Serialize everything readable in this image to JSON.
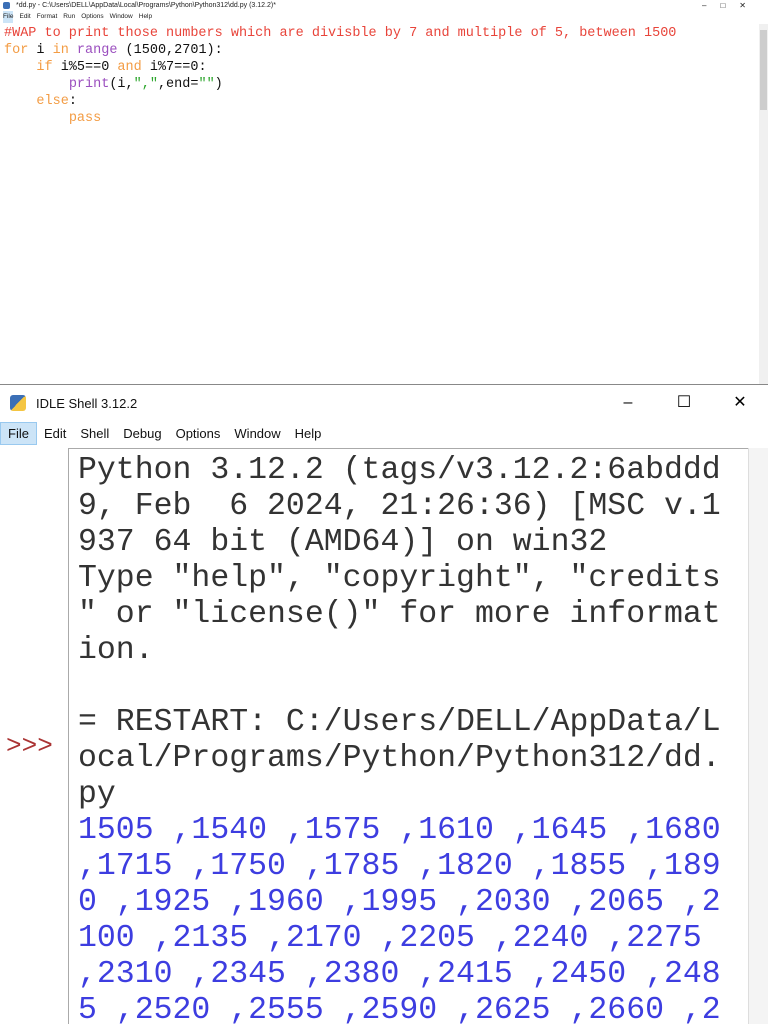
{
  "editor": {
    "title": "*dd.py - C:\\Users\\DELL\\AppData\\Local\\Programs\\Python\\Python312\\dd.py (3.12.2)*",
    "controls": [
      "–",
      "□",
      "✕"
    ],
    "menu": [
      "File",
      "Edit",
      "Format",
      "Run",
      "Options",
      "Window",
      "Help"
    ],
    "code": {
      "l1": "#WAP to print those numbers which are divisble by 7 and multiple of 5, between 1500",
      "for": "for",
      "i": " i ",
      "in": "in",
      "range": " range",
      "args": " (1500,2701):",
      "if": "if",
      "cond1": " i%5==0 ",
      "and": "and",
      "cond2": " i%7==0:",
      "print": "print",
      "p1": "(i,",
      "str": "\",\"",
      "p2": ",end=",
      "str2": "\"\"",
      "p3": ")",
      "else": "else",
      "colon": ":",
      "pass": "pass"
    }
  },
  "shell": {
    "title": "IDLE Shell 3.12.2",
    "controls": [
      "–",
      "☐",
      "✕"
    ],
    "menu": [
      "File",
      "Edit",
      "Shell",
      "Debug",
      "Options",
      "Window",
      "Help"
    ],
    "prompt": ">>>",
    "banner": [
      "Python 3.12.2 (tags/v3.12.2:6abddd",
      "9, Feb  6 2024, 21:26:36) [MSC v.1",
      "937 64 bit (AMD64)] on win32",
      "Type \"help\", \"copyright\", \"credits",
      "\" or \"license()\" for more informat",
      "ion."
    ],
    "restart": [
      "= RESTART: C:/Users/DELL/AppData/L",
      "ocal/Programs/Python/Python312/dd.",
      "py"
    ],
    "output": [
      "1505 ,1540 ,1575 ,1610 ,1645 ,1680",
      ",1715 ,1750 ,1785 ,1820 ,1855 ,189",
      "0 ,1925 ,1960 ,1995 ,2030 ,2065 ,2",
      "100 ,2135 ,2170 ,2205 ,2240 ,2275",
      ",2310 ,2345 ,2380 ,2415 ,2450 ,248",
      "5 ,2520 ,2555 ,2590 ,2625 ,2660 ,2"
    ]
  }
}
